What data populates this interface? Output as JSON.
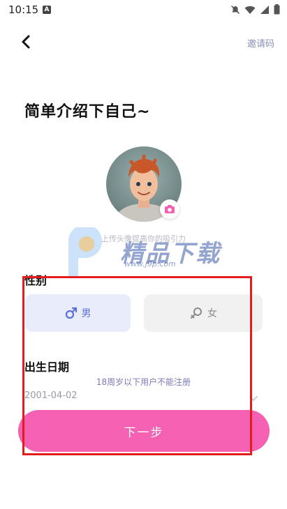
{
  "status_bar": {
    "time": "10:15",
    "app_icon": "A",
    "icons": [
      "mute-icon",
      "wifi-icon",
      "signal-icon",
      "battery-icon"
    ]
  },
  "header": {
    "back_icon": "chevron-left-icon",
    "invite_code": "邀请码"
  },
  "title": "简单介绍下自己~",
  "avatar": {
    "camera_icon": "camera-icon",
    "hint": "上传头像提高你的吸引力"
  },
  "watermark": {
    "brand": "精品下载",
    "url": "www.j9p.com"
  },
  "gender": {
    "label": "性别",
    "options": [
      {
        "label": "男",
        "icon": "male-symbol-icon",
        "selected": true
      },
      {
        "label": "女",
        "icon": "female-symbol-icon",
        "selected": false
      }
    ]
  },
  "birthday": {
    "label": "出生日期",
    "note": "18周岁以下用户不能注册",
    "value": "2001-04-02",
    "dropdown_icon": "chevron-down-icon"
  },
  "next_button": "下一步",
  "colors": {
    "accent_pink": "#f461b3",
    "male_selected_bg": "#e8ecfb",
    "male_selected_text": "#5b6fd6",
    "unselected_bg": "#f1f1f1",
    "highlight_red": "#e21d1d",
    "invite_text": "#8a90b8"
  }
}
